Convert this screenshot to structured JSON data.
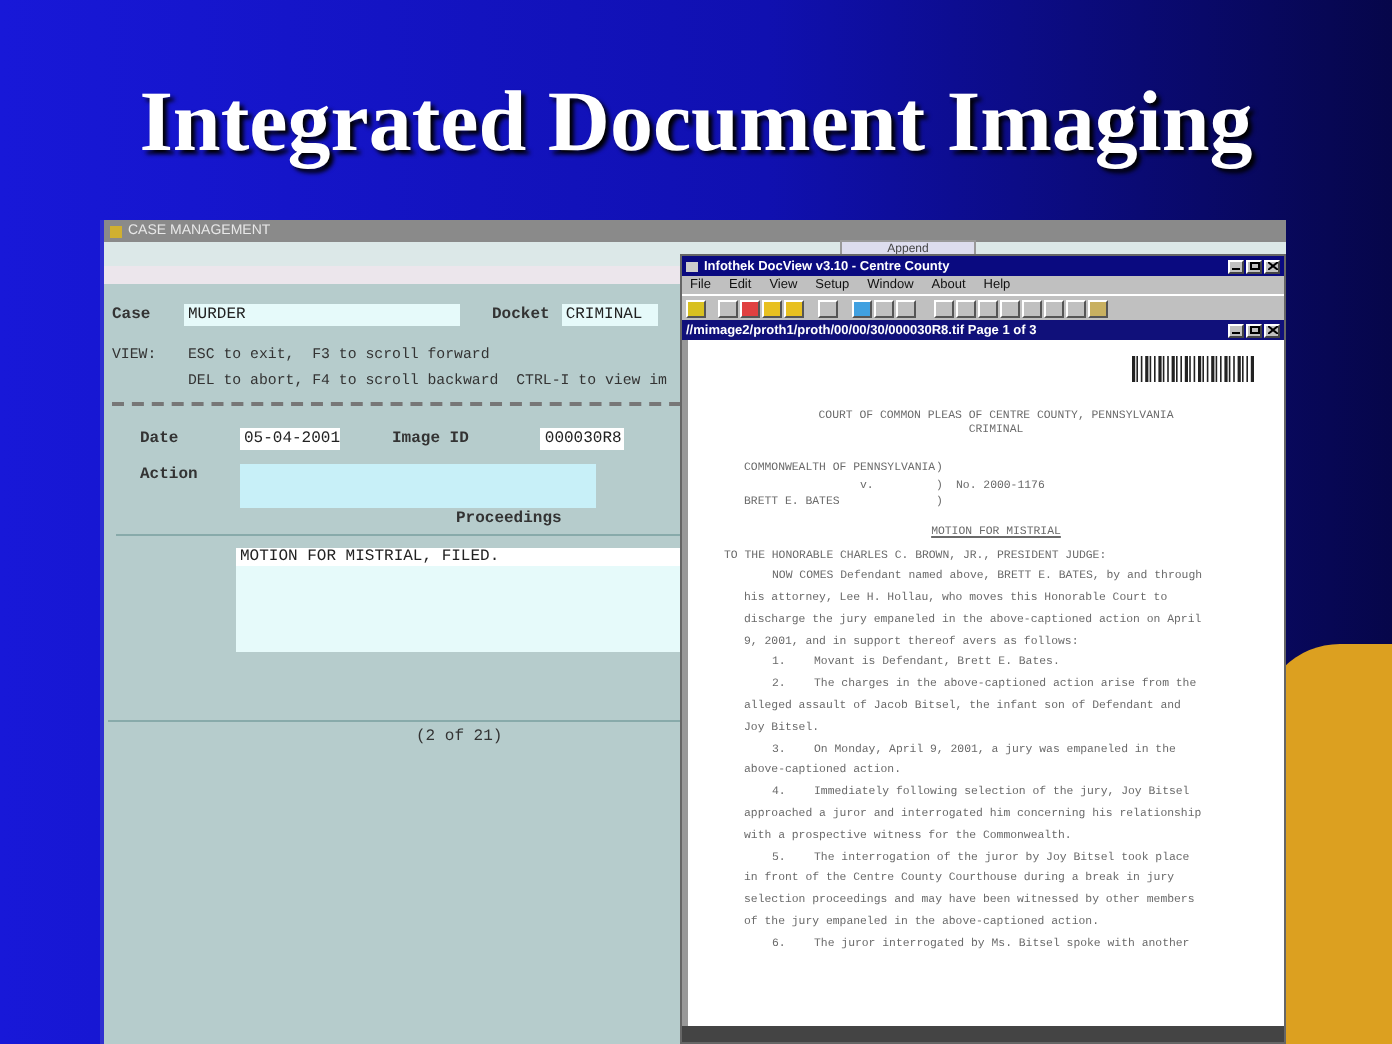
{
  "slide": {
    "title": "Integrated Document Imaging"
  },
  "case_window": {
    "title": "CASE MANAGEMENT",
    "behind_button": "Append",
    "case": {
      "label": "Case",
      "value": "MURDER"
    },
    "docket": {
      "label": "Docket",
      "value": "CRIMINAL"
    },
    "view_help": {
      "label": "VIEW:",
      "lines": [
        "ESC to exit,  F3 to scroll forward",
        "DEL to abort, F4 to scroll backward  CTRL-I to view im"
      ]
    },
    "date": {
      "label": "Date",
      "value": "05-04-2001"
    },
    "image_id": {
      "label": "Image ID",
      "value": "000030R8"
    },
    "action": {
      "label": "Action"
    },
    "proceedings": {
      "label": "Proceedings",
      "text": "MOTION FOR MISTRIAL, FILED."
    },
    "record_count": "(2 of 21)"
  },
  "docview": {
    "title": "Infothek DocView v3.10  - Centre County",
    "menu": [
      "File",
      "Edit",
      "View",
      "Setup",
      "Window",
      "About",
      "Help"
    ],
    "document_window": {
      "title": "//mimage2/proth1/proth/00/00/30/000030R8.tif Page 1 of 3"
    },
    "document": {
      "heading": [
        "COURT OF COMMON PLEAS OF CENTRE COUNTY, PENNSYLVANIA",
        "CRIMINAL"
      ],
      "caption_left": [
        "COMMONWEALTH OF PENNSYLVANIA",
        "v.",
        "BRETT E. BATES"
      ],
      "caption_brackets": [
        ")",
        ")",
        ")"
      ],
      "docket_no": "No. 2000-1176",
      "motion_title": "MOTION FOR MISTRIAL",
      "salutation": "TO THE HONORABLE CHARLES C. BROWN, JR., PRESIDENT JUDGE:",
      "intro": "NOW COMES Defendant named above, BRETT E. BATES, by and through his attorney, Lee H. Hollau, who moves this Honorable Court to discharge the jury empaneled in the above-captioned action on April 9, 2001, and in support thereof avers as follows:",
      "paragraphs": [
        {
          "number": "1.",
          "text": "Movant is Defendant, Brett E. Bates."
        },
        {
          "number": "2.",
          "text": "The charges in the above-captioned action arise from the alleged assault of Jacob Bitsel, the infant son of Defendant and Joy Bitsel."
        },
        {
          "number": "3.",
          "text": "On Monday, April 9, 2001, a jury was empaneled in the above-captioned action."
        },
        {
          "number": "4.",
          "text": "Immediately following selection of the jury, Joy Bitsel approached a juror and interrogated him concerning his relationship with a prospective witness for the Commonwealth."
        },
        {
          "number": "5.",
          "text": "The interrogation of the juror by Joy Bitsel took place in front of the Centre County Courthouse during a break in jury selection proceedings and may have been witnessed by other members of the jury empaneled in the above-captioned action."
        },
        {
          "number": "6.",
          "text": "The juror interrogated by Ms. Bitsel spoke with another"
        }
      ]
    }
  }
}
